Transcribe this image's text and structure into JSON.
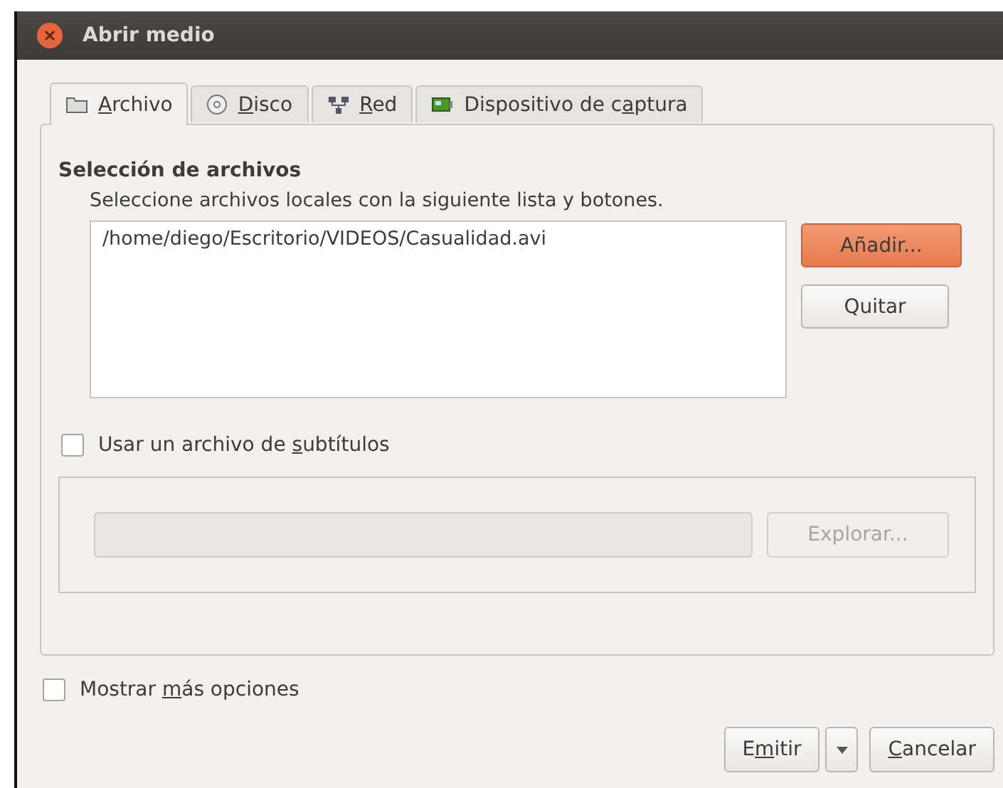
{
  "window": {
    "title": "Abrir medio"
  },
  "tabs": [
    {
      "label": {
        "key": "A",
        "after": "rchivo"
      },
      "kind": "folder",
      "selected": true
    },
    {
      "label": {
        "key": "D",
        "after": "isco"
      },
      "kind": "disc",
      "selected": false
    },
    {
      "label": {
        "key": "R",
        "after": "ed"
      },
      "kind": "network",
      "selected": false
    },
    {
      "label": {
        "before": "Dispositivo de c",
        "key": "a",
        "after": "ptura"
      },
      "kind": "card",
      "selected": false
    }
  ],
  "file_selection": {
    "heading": "Selección de archivos",
    "description": "Seleccione archivos locales con la siguiente lista y botones.",
    "files": [
      "/home/diego/Escritorio/VIDEOS/Casualidad.avi"
    ],
    "add_button": {
      "label": "Añadir...",
      "disabled": false
    },
    "remove_button": {
      "label": "Quitar",
      "disabled": false
    }
  },
  "subtitles": {
    "label": {
      "before": "Usar un archivo de ",
      "key": "s",
      "after": "ubtítulos"
    },
    "checked": false,
    "browse_button": {
      "label": "Explorar...",
      "disabled": true
    }
  },
  "more_options": {
    "label": {
      "before": "Mostrar ",
      "key": "m",
      "after": "ás opciones"
    },
    "checked": false
  },
  "buttons": [
    {
      "label": {
        "before": "E",
        "key": "m",
        "after": "itir"
      }
    },
    {
      "label": {
        "key": "C",
        "after": "ancelar"
      }
    }
  ]
}
